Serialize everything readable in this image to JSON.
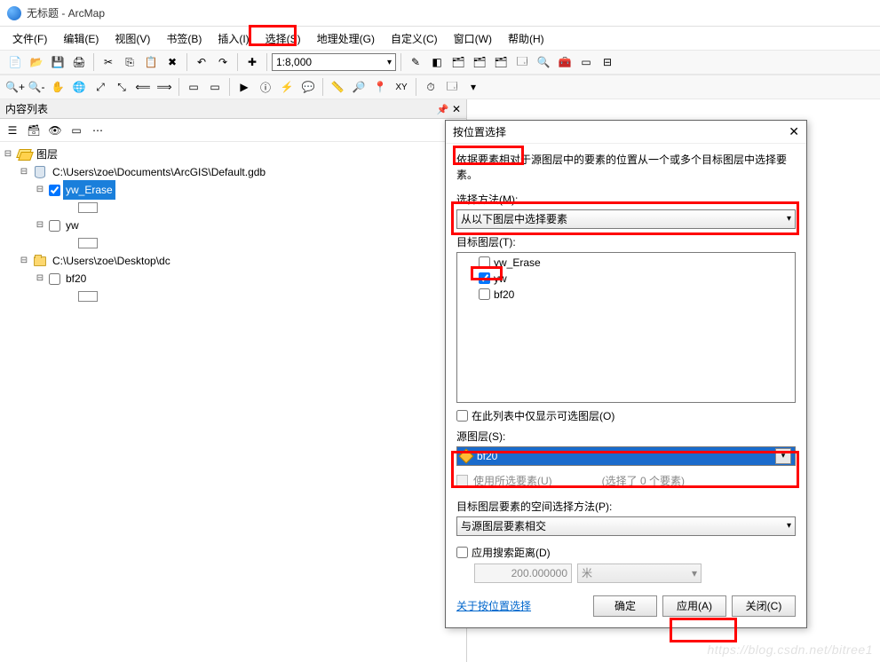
{
  "title": "无标题 - ArcMap",
  "menu": {
    "file": "文件(F)",
    "edit": "编辑(E)",
    "view": "视图(V)",
    "bookmarks": "书签(B)",
    "insert": "插入(I)",
    "selection": "选择(S)",
    "geoprocessing": "地理处理(G)",
    "customize": "自定义(C)",
    "windows": "窗口(W)",
    "help": "帮助(H)"
  },
  "scale": "1:8,000",
  "toc": {
    "title": "内容列表",
    "root": "图层",
    "gdb": "C:\\Users\\zoe\\Documents\\ArcGIS\\Default.gdb",
    "layer_yw_erase": "yw_Erase",
    "layer_yw": "yw",
    "folder_dc": "C:\\Users\\zoe\\Desktop\\dc",
    "layer_bf20": "bf20"
  },
  "dialog": {
    "title": "按位置选择",
    "desc": "依据要素相对于源图层中的要素的位置从一个或多个目标图层中选择要素。",
    "method_label": "选择方法(M):",
    "method_value": "从以下图层中选择要素",
    "target_label": "目标图层(T):",
    "targets": {
      "yw_erase": "yw_Erase",
      "yw": "yw",
      "bf20": "bf20"
    },
    "only_vis": "在此列表中仅显示可选图层(O)",
    "source_label": "源图层(S):",
    "source_value": "bf20",
    "use_selected": "使用所选要素(U)",
    "selected_count": "(选择了 0 个要素)",
    "spatial_label": "目标图层要素的空间选择方法(P):",
    "spatial_value": "与源图层要素相交",
    "apply_dist": "应用搜索距离(D)",
    "dist_value": "200.000000",
    "dist_unit": "米",
    "help_link": "关于按位置选择",
    "ok": "确定",
    "apply": "应用(A)",
    "close": "关闭(C)"
  },
  "watermark": "https://blog.csdn.net/bitree1"
}
